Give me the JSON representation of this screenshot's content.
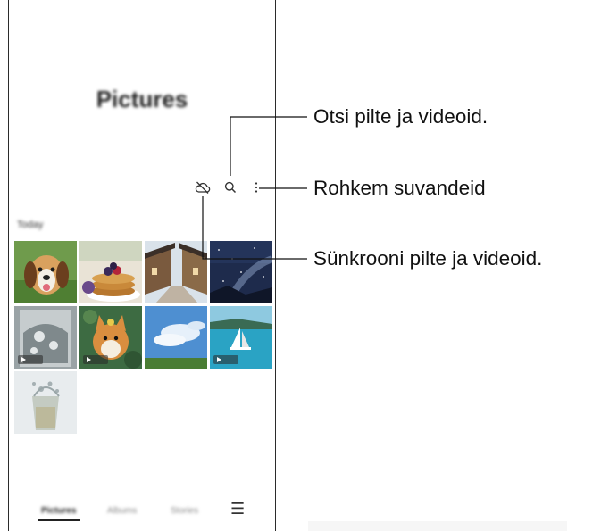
{
  "gallery": {
    "title": "Pictures",
    "date_label": "Today",
    "toolbar": {
      "icons": [
        "cloud-off-icon",
        "search-icon",
        "more-options-icon"
      ]
    },
    "photos": [
      {
        "subject": "beagle puppy",
        "type": "photo"
      },
      {
        "subject": "pancakes with berries",
        "type": "photo"
      },
      {
        "subject": "village street",
        "type": "photo"
      },
      {
        "subject": "starry night sky",
        "type": "photo"
      },
      {
        "subject": "water splash glass",
        "type": "video"
      },
      {
        "subject": "corgi with flower crown",
        "type": "video"
      },
      {
        "subject": "blue sky with clouds",
        "type": "photo"
      },
      {
        "subject": "sailboat on sea",
        "type": "video"
      },
      {
        "subject": "glass with ice splash",
        "type": "photo"
      }
    ],
    "bottom_nav": {
      "pictures": "Pictures",
      "albums": "Albums",
      "stories": "Stories",
      "menu": "☰"
    }
  },
  "callouts": {
    "search": "Otsi pilte ja videoid.",
    "more_options": "Rohkem suvandeid",
    "sync": "Sünkrooni pilte ja videoid."
  }
}
